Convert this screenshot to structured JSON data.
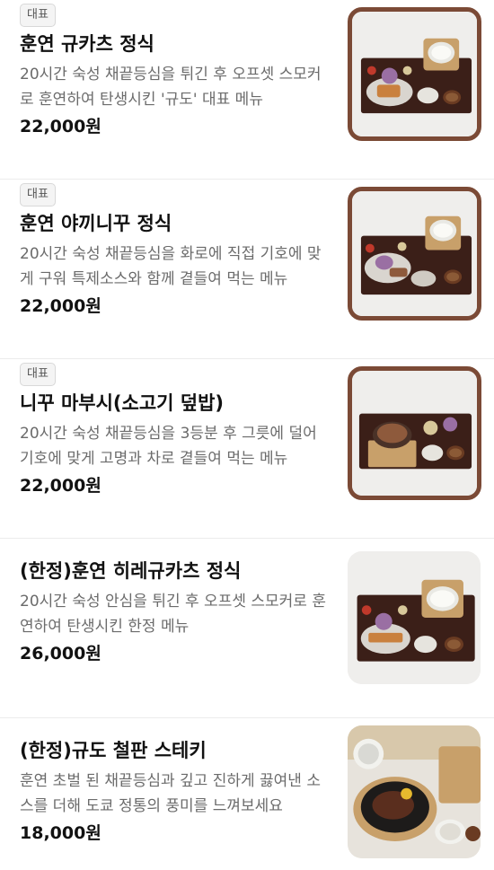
{
  "menu": {
    "items": [
      {
        "badge": "대표",
        "title": "훈연 규카츠 정식",
        "description": "20시간 숙성 채끝등심을 튀긴 후 오프셋 스모커로 훈연하여 탄생시킨 '규도' 대표 메뉴",
        "price": "22,000원"
      },
      {
        "badge": "대표",
        "title": "훈연 야끼니꾸 정식",
        "description": "20시간 숙성 채끝등심을 화로에 직접 기호에 맞게 구워 특제소스와 함께 곁들여 먹는 메뉴",
        "price": "22,000원"
      },
      {
        "badge": "대표",
        "title": "니꾸 마부시(소고기 덮밥)",
        "description": "20시간 숙성 채끝등심을 3등분 후 그릇에 덜어 기호에 맞게 고명과 차로 곁들여 먹는 메뉴",
        "price": "22,000원"
      },
      {
        "badge": "",
        "title": "(한정)훈연 히레규카츠 정식",
        "description": "20시간 숙성 안심을 튀긴 후 오프셋 스모커로 훈연하여 탄생시킨 한정 메뉴",
        "price": "26,000원"
      },
      {
        "badge": "",
        "title": "(한정)규도 철판 스테키",
        "description": "훈연 초벌 된 채끝등심과 깊고 진하게 끓여낸 소스를 더해 도쿄 정통의 풍미를 느껴보세요",
        "price": "18,000원"
      }
    ]
  },
  "colors": {
    "frame": "#7b4a36",
    "tray": "#3b1f18",
    "badge_bg": "#f4f4f4"
  }
}
